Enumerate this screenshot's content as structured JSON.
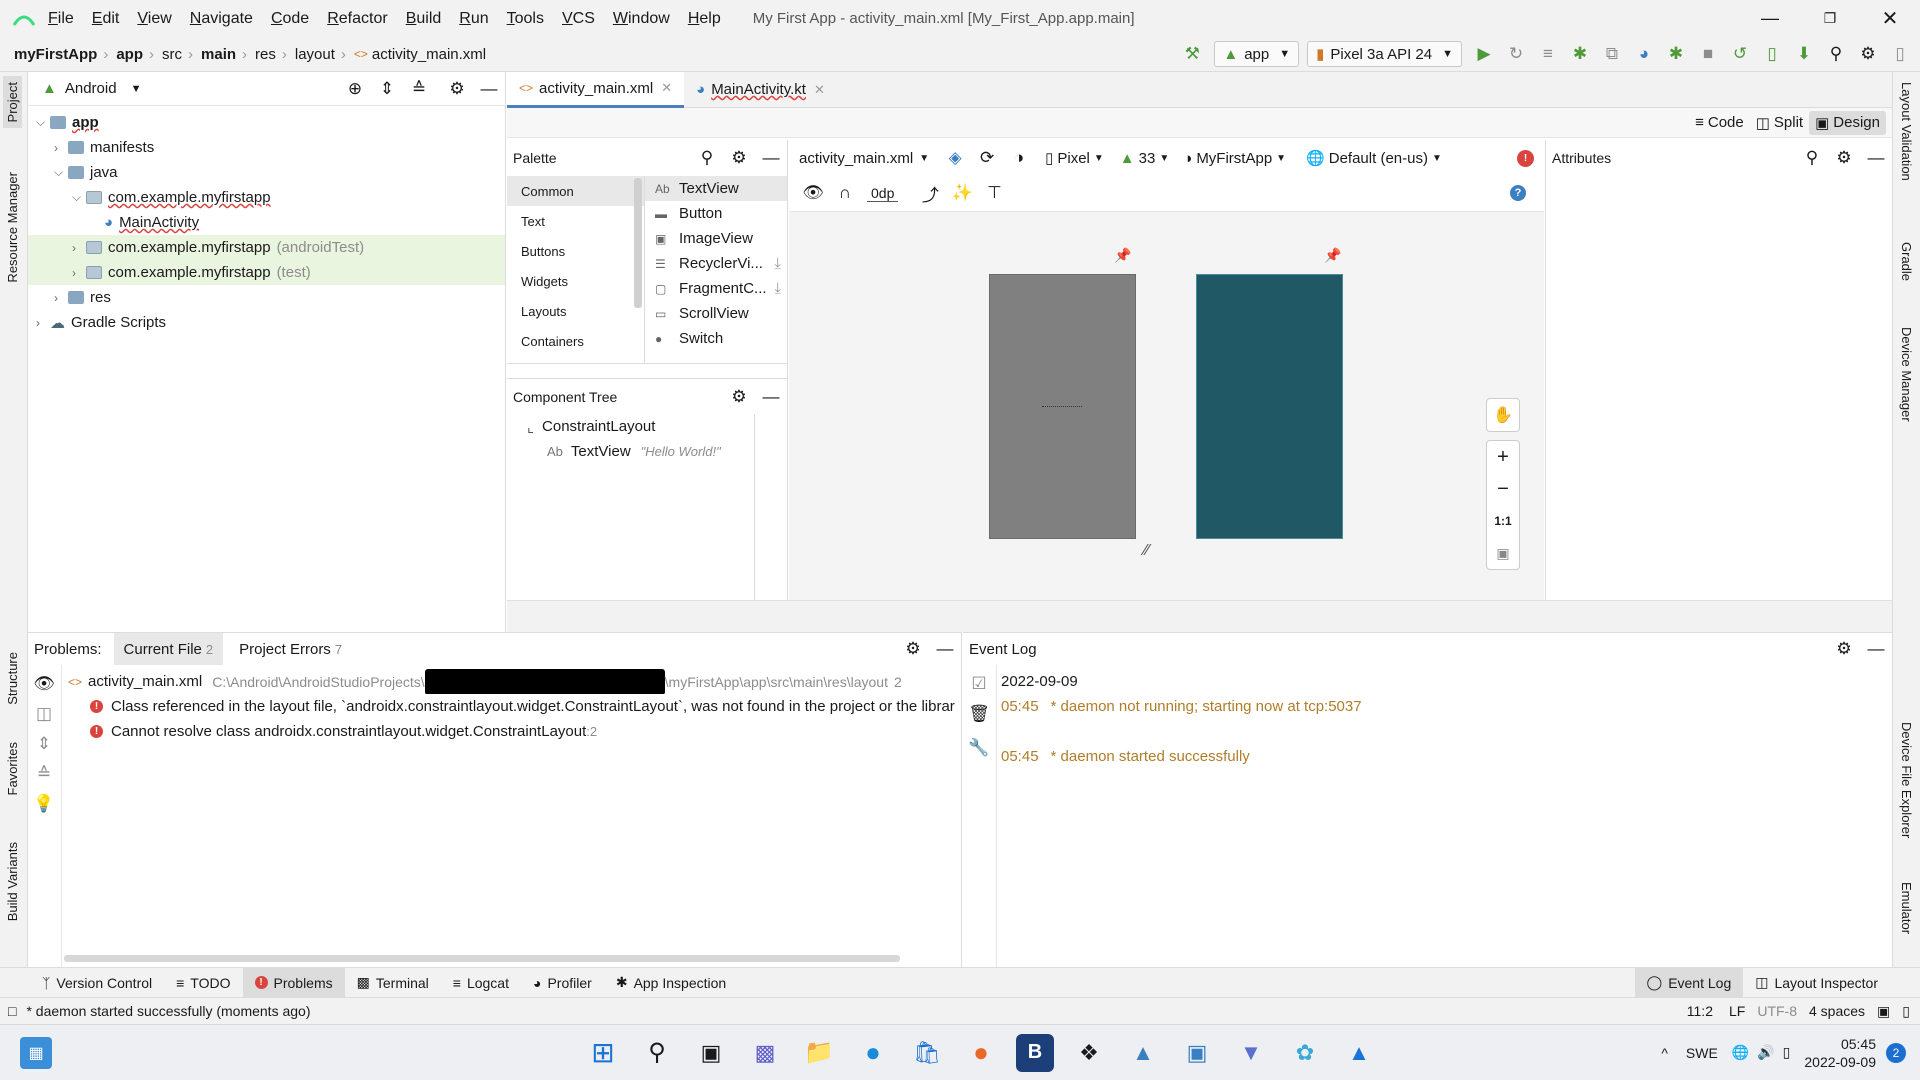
{
  "menu": [
    "File",
    "Edit",
    "View",
    "Navigate",
    "Code",
    "Refactor",
    "Build",
    "Run",
    "Tools",
    "VCS",
    "Window",
    "Help"
  ],
  "window_title": "My First App - activity_main.xml [My_First_App.app.main]",
  "breadcrumb": [
    "myFirstApp",
    "app",
    "src",
    "main",
    "res",
    "layout",
    "activity_main.xml"
  ],
  "run_config": "app",
  "device": "Pixel 3a API 24",
  "project_view": "Android",
  "tree": [
    {
      "label": "app",
      "indent": 0,
      "arrow": "v",
      "kind": "module"
    },
    {
      "label": "manifests",
      "indent": 1,
      "arrow": ">",
      "kind": "folder"
    },
    {
      "label": "java",
      "indent": 1,
      "arrow": "v",
      "kind": "folder"
    },
    {
      "label": "com.example.myfirstapp",
      "indent": 2,
      "arrow": "v",
      "kind": "pkg",
      "suffix": ""
    },
    {
      "label": "MainActivity",
      "indent": 3,
      "arrow": "",
      "kind": "class"
    },
    {
      "label": "com.example.myfirstapp",
      "indent": 2,
      "arrow": ">",
      "kind": "pkg",
      "suffix": "(androidTest)"
    },
    {
      "label": "com.example.myfirstapp",
      "indent": 2,
      "arrow": ">",
      "kind": "pkg",
      "suffix": "(test)"
    },
    {
      "label": "res",
      "indent": 1,
      "arrow": ">",
      "kind": "folder"
    },
    {
      "label": "Gradle Scripts",
      "indent": 0,
      "arrow": ">",
      "kind": "gradle"
    }
  ],
  "editor_tabs": [
    {
      "label": "activity_main.xml",
      "active": true
    },
    {
      "label": "MainActivity.kt",
      "active": false
    }
  ],
  "view_modes": [
    "Code",
    "Split",
    "Design"
  ],
  "palette": {
    "title": "Palette",
    "categories": [
      "Common",
      "Text",
      "Buttons",
      "Widgets",
      "Layouts",
      "Containers"
    ],
    "items": [
      "TextView",
      "Button",
      "ImageView",
      "RecyclerVi...",
      "FragmentC...",
      "ScrollView",
      "Switch"
    ]
  },
  "component_tree": {
    "title": "Component Tree",
    "root": "ConstraintLayout",
    "child": "TextView",
    "child_text": "\"Hello World!\""
  },
  "design_toolbar": {
    "file": "activity_main.xml",
    "device": "Pixel",
    "api": "33",
    "theme": "MyFirstApp",
    "locale": "Default (en-us)",
    "margin": "0dp"
  },
  "zoom_fit": "1:1",
  "attributes_title": "Attributes",
  "problems": {
    "label": "Problems:",
    "tab_current": "Current File",
    "tab_current_count": "2",
    "tab_project": "Project Errors",
    "tab_project_count": "7",
    "file": "activity_main.xml",
    "path_start": "C:\\Android\\AndroidStudioProjects\\",
    "path_end": "\\myFirstApp\\app\\src\\main\\res\\layout",
    "file_count": "2",
    "errors": [
      {
        "text": "Class referenced in the layout file, `androidx.constraintlayout.widget.ConstraintLayout`, was not found in the project or the librar",
        "loc": ""
      },
      {
        "text": "Cannot resolve class androidx.constraintlayout.widget.ConstraintLayout",
        "loc": ":2"
      }
    ]
  },
  "event_log": {
    "title": "Event Log",
    "date": "2022-09-09",
    "entries": [
      {
        "time": "05:45",
        "text": "* daemon not running; starting now at tcp:5037"
      },
      {
        "time": "05:45",
        "text": "* daemon started successfully"
      }
    ]
  },
  "tool_windows_left": [
    "Version Control",
    "TODO",
    "Problems",
    "Terminal",
    "Logcat",
    "Profiler",
    "App Inspection"
  ],
  "tool_windows_right": [
    "Event Log",
    "Layout Inspector"
  ],
  "left_strip": [
    "Project",
    "Resource Manager",
    "Structure",
    "Favorites",
    "Build Variants"
  ],
  "right_strip": [
    "Layout Validation",
    "Gradle",
    "Device Manager",
    "Device File Explorer",
    "Emulator"
  ],
  "status": {
    "message": "* daemon started successfully (moments ago)",
    "position": "11:2",
    "line_sep": "LF",
    "encoding": "UTF-8",
    "indent": "4 spaces"
  },
  "taskbar": {
    "lang": "SWE",
    "time": "05:45",
    "date": "2022-09-09",
    "notif": "2"
  },
  "colors": {
    "accent": "#4a7fc1",
    "blueprint": "#215866",
    "design_preview": "#808080",
    "error": "#d9443f",
    "green": "#4e9a3a"
  }
}
